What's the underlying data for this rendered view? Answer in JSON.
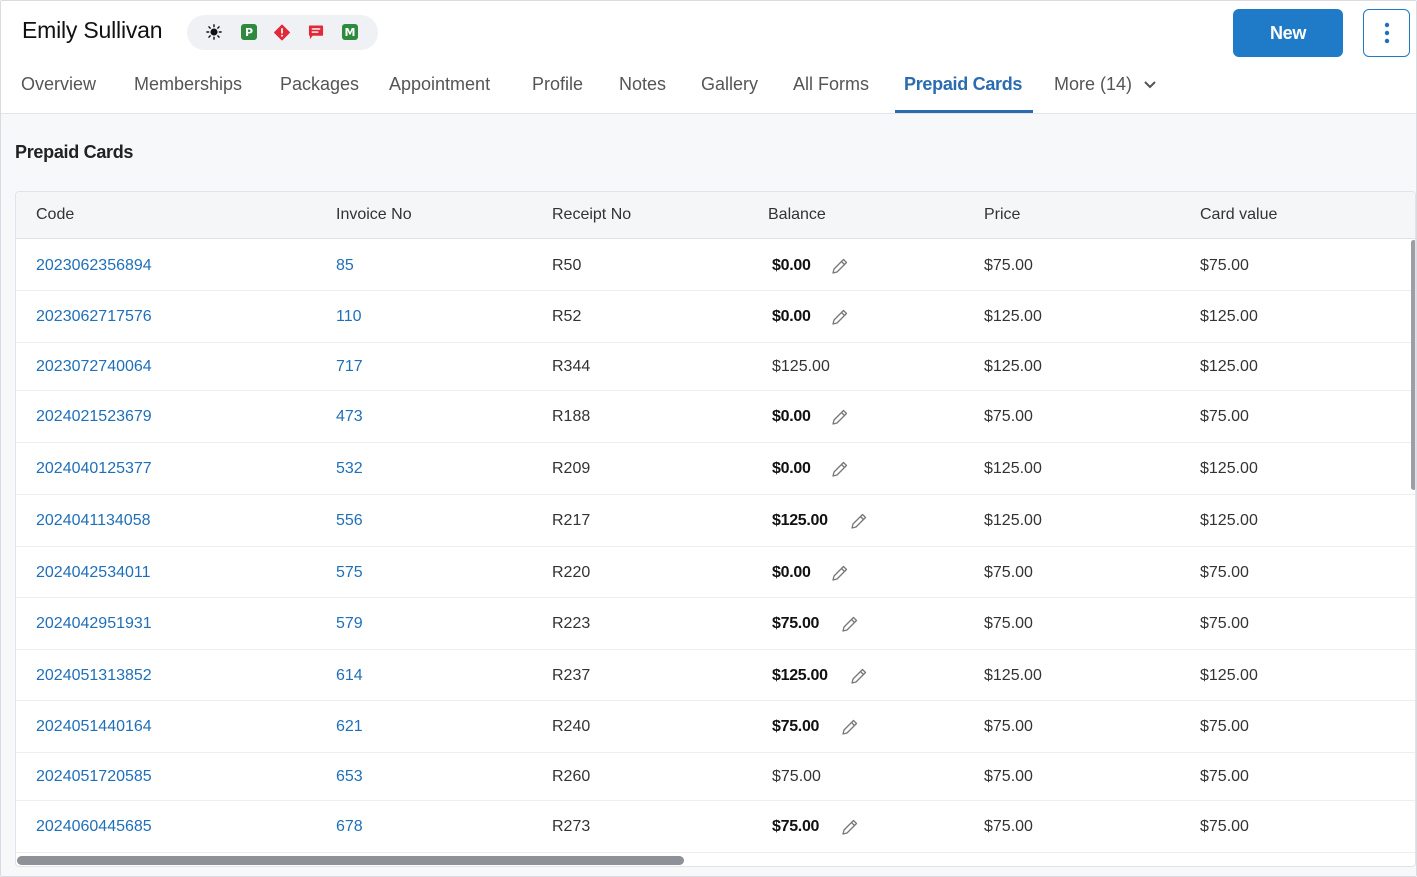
{
  "customer": {
    "name": "Emily Sullivan",
    "badges": [
      {
        "icon": "sun-icon",
        "text": ""
      },
      {
        "icon": "p-badge-icon",
        "text": "P",
        "color": "#2e8b3e"
      },
      {
        "icon": "alert-icon",
        "text": "!",
        "color": "#e02a3a"
      },
      {
        "icon": "message-icon",
        "text": "",
        "color": "#e02a3a"
      },
      {
        "icon": "m-badge-icon",
        "text": "M",
        "color": "#2e8b3e"
      }
    ]
  },
  "actions": {
    "new_label": "New"
  },
  "tabs": [
    {
      "label": "Overview"
    },
    {
      "label": "Memberships"
    },
    {
      "label": "Packages"
    },
    {
      "label": "Appointment"
    },
    {
      "label": "Profile"
    },
    {
      "label": "Notes"
    },
    {
      "label": "Gallery"
    },
    {
      "label": "All Forms"
    },
    {
      "label": "Prepaid Cards",
      "active": true
    },
    {
      "label": "More (14)"
    }
  ],
  "section": {
    "title": "Prepaid Cards"
  },
  "table": {
    "columns": [
      "Code",
      "Invoice No",
      "Receipt No",
      "Balance",
      "Price",
      "Card value"
    ],
    "rows": [
      {
        "code": "2023062356894",
        "invoice": "85",
        "receipt": "R50",
        "balance": "$0.00",
        "editable": true,
        "price": "$75.00",
        "card_value": "$75.00"
      },
      {
        "code": "2023062717576",
        "invoice": "110",
        "receipt": "R52",
        "balance": "$0.00",
        "editable": true,
        "price": "$125.00",
        "card_value": "$125.00"
      },
      {
        "code": "2023072740064",
        "invoice": "717",
        "receipt": "R344",
        "balance": "$125.00",
        "editable": false,
        "price": "$125.00",
        "card_value": "$125.00"
      },
      {
        "code": "2024021523679",
        "invoice": "473",
        "receipt": "R188",
        "balance": "$0.00",
        "editable": true,
        "price": "$75.00",
        "card_value": "$75.00"
      },
      {
        "code": "2024040125377",
        "invoice": "532",
        "receipt": "R209",
        "balance": "$0.00",
        "editable": true,
        "price": "$125.00",
        "card_value": "$125.00"
      },
      {
        "code": "2024041134058",
        "invoice": "556",
        "receipt": "R217",
        "balance": "$125.00",
        "editable": true,
        "price": "$125.00",
        "card_value": "$125.00"
      },
      {
        "code": "2024042534011",
        "invoice": "575",
        "receipt": "R220",
        "balance": "$0.00",
        "editable": true,
        "price": "$75.00",
        "card_value": "$75.00"
      },
      {
        "code": "2024042951931",
        "invoice": "579",
        "receipt": "R223",
        "balance": "$75.00",
        "editable": true,
        "price": "$75.00",
        "card_value": "$75.00"
      },
      {
        "code": "2024051313852",
        "invoice": "614",
        "receipt": "R237",
        "balance": "$125.00",
        "editable": true,
        "price": "$125.00",
        "card_value": "$125.00"
      },
      {
        "code": "2024051440164",
        "invoice": "621",
        "receipt": "R240",
        "balance": "$75.00",
        "editable": true,
        "price": "$75.00",
        "card_value": "$75.00"
      },
      {
        "code": "2024051720585",
        "invoice": "653",
        "receipt": "R260",
        "balance": "$75.00",
        "editable": false,
        "price": "$75.00",
        "card_value": "$75.00"
      },
      {
        "code": "2024060445685",
        "invoice": "678",
        "receipt": "R273",
        "balance": "$75.00",
        "editable": true,
        "price": "$75.00",
        "card_value": "$75.00"
      }
    ]
  }
}
